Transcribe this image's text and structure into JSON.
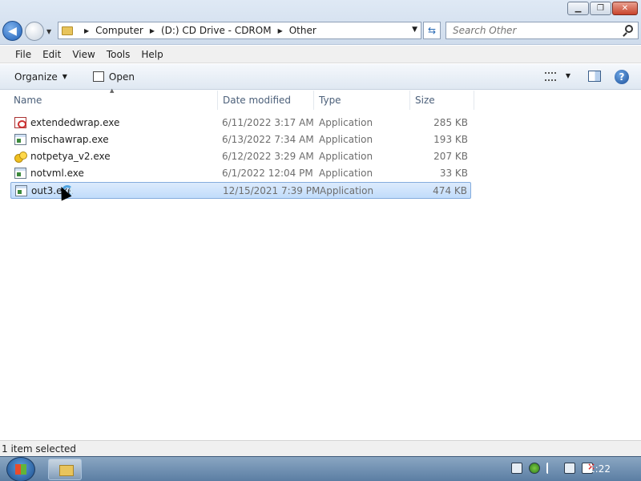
{
  "window": {
    "controls": {
      "minimize": "▁",
      "maximize": "❐",
      "close": "✕"
    }
  },
  "address": {
    "crumbs": [
      "Computer",
      "(D:) CD Drive - CDROM",
      "Other"
    ]
  },
  "search": {
    "placeholder": "Search Other"
  },
  "menu": {
    "items": [
      "File",
      "Edit",
      "View",
      "Tools",
      "Help"
    ]
  },
  "commands": {
    "organize": "Organize",
    "open": "Open",
    "help": "?"
  },
  "columns": {
    "name": "Name",
    "date": "Date modified",
    "type": "Type",
    "size": "Size"
  },
  "files": [
    {
      "name": "extendedwrap.exe",
      "date": "6/11/2022 3:17 AM",
      "type": "Application",
      "size": "285 KB",
      "icon": "pdf-app-icon"
    },
    {
      "name": "mischawrap.exe",
      "date": "6/13/2022 7:34 AM",
      "type": "Application",
      "size": "193 KB",
      "icon": "app-icon"
    },
    {
      "name": "notpetya_v2.exe",
      "date": "6/12/2022 3:29 AM",
      "type": "Application",
      "size": "207 KB",
      "icon": "yellow-app-icon"
    },
    {
      "name": "notvml.exe",
      "date": "6/1/2022 12:04 PM",
      "type": "Application",
      "size": "33 KB",
      "icon": "app-icon"
    },
    {
      "name": "out3.exe",
      "date": "12/15/2021 7:39 PM",
      "type": "Application",
      "size": "474 KB",
      "icon": "app-icon",
      "selected": true
    }
  ],
  "status": {
    "text": "1 item selected"
  },
  "taskbar": {
    "clock": "1:22"
  },
  "colors": {
    "selection": "#c1dcfb",
    "accent": "#1d5fb8",
    "taskbar": "#5b7ea3"
  }
}
